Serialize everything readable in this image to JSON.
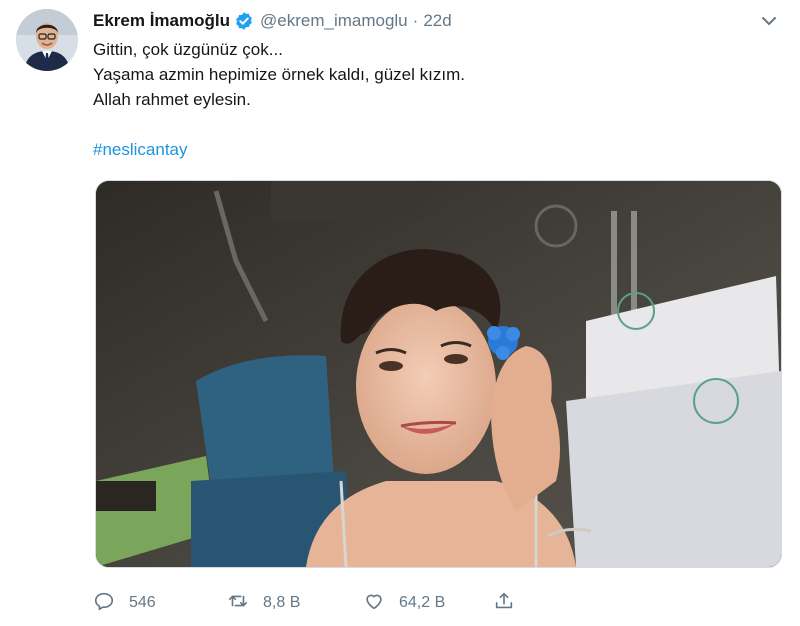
{
  "tweet": {
    "display_name": "Ekrem İmamoğlu",
    "handle": "@ekrem_imamoglu",
    "separator": "·",
    "time": "22d",
    "text_lines": [
      "Gittin, çok üzgünüz çok...",
      "Yaşama azmin hepimize örnek kaldı, güzel kızım.",
      "Allah rahmet eylesin."
    ],
    "hashtag": "#neslicantay"
  },
  "actions": {
    "replies": "546",
    "retweets": "8,8 B",
    "likes": "64,2 B"
  },
  "icons": {
    "verified": "verified-badge-icon",
    "menu": "chevron-down-icon",
    "reply": "reply-icon",
    "retweet": "retweet-icon",
    "like": "heart-icon",
    "share": "share-icon"
  },
  "colors": {
    "text": "#14171a",
    "muted": "#657786",
    "link": "#1b95e0",
    "verified": "#1da1f2"
  }
}
